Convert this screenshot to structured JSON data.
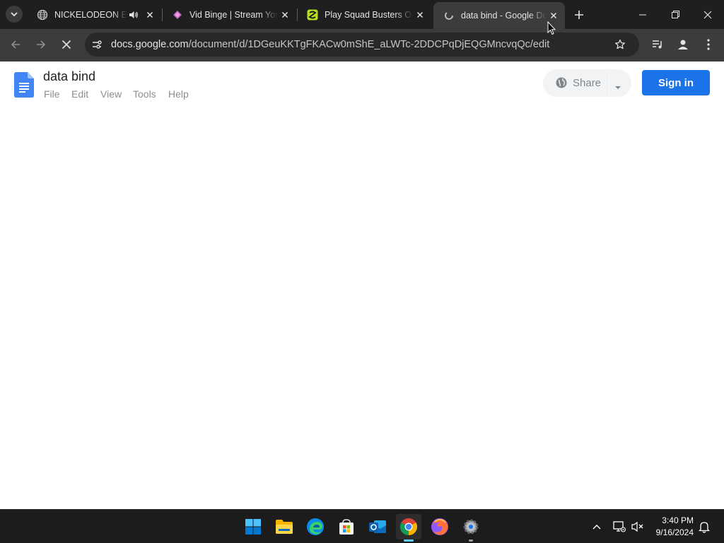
{
  "browser": {
    "tabs": [
      {
        "title": "NICKELODEON EA",
        "icon": "globe-icon",
        "audio": true
      },
      {
        "title": "Vid Binge | Stream You",
        "icon": "vidbinge-icon"
      },
      {
        "title": "Play Squad Busters On",
        "icon": "squad-busters-icon"
      },
      {
        "title": "data bind - Google Do",
        "icon": "loading-icon",
        "active": true
      }
    ],
    "url_host": "docs.google.com",
    "url_path": "/document/d/1DGeuKKTgFKACw0mShE_aLWTc-2DDCPqDjEQGMncvqQc/edit"
  },
  "doc": {
    "title": "data bind",
    "menu": [
      "File",
      "Edit",
      "View",
      "Tools",
      "Help"
    ],
    "share_label": "Share",
    "signin_label": "Sign in"
  },
  "taskbar": {
    "apps": [
      "start-icon",
      "file-explorer-icon",
      "edge-icon",
      "store-icon",
      "outlook-icon",
      "chrome-icon",
      "firefox-icon",
      "settings-icon"
    ],
    "time": "3:40 PM",
    "date": "9/16/2024"
  },
  "colors": {
    "accent": "#1a73e8",
    "docs_blue": "#4285f4",
    "chrome_dark": "#1f1f1f"
  }
}
